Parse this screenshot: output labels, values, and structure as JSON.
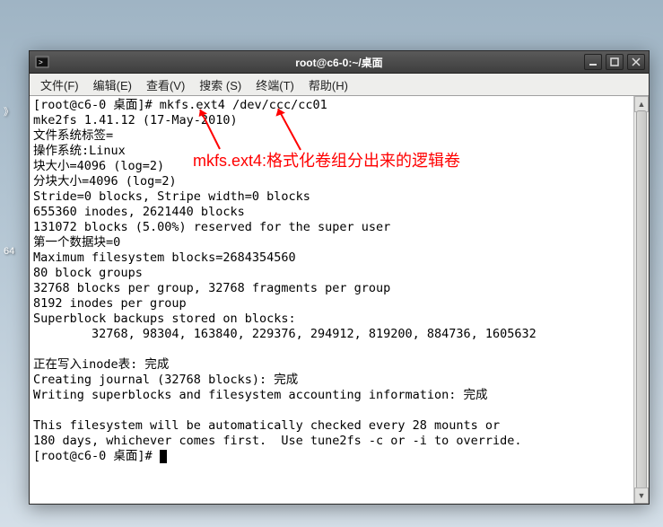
{
  "desktop": {
    "label1": "》",
    "label2": "64"
  },
  "window": {
    "title": "root@c6-0:~/桌面"
  },
  "menubar": {
    "file": "文件(F)",
    "edit": "编辑(E)",
    "view": "查看(V)",
    "search": "搜索 (S)",
    "terminal": "终端(T)",
    "help": "帮助(H)"
  },
  "terminal": {
    "lines": [
      "[root@c6-0 桌面]# mkfs.ext4 /dev/ccc/cc01",
      "mke2fs 1.41.12 (17-May-2010)",
      "文件系统标签=",
      "操作系统:Linux",
      "块大小=4096 (log=2)",
      "分块大小=4096 (log=2)",
      "Stride=0 blocks, Stripe width=0 blocks",
      "655360 inodes, 2621440 blocks",
      "131072 blocks (5.00%) reserved for the super user",
      "第一个数据块=0",
      "Maximum filesystem blocks=2684354560",
      "80 block groups",
      "32768 blocks per group, 32768 fragments per group",
      "8192 inodes per group",
      "Superblock backups stored on blocks:",
      "        32768, 98304, 163840, 229376, 294912, 819200, 884736, 1605632",
      "",
      "正在写入inode表: 完成",
      "Creating journal (32768 blocks): 完成",
      "Writing superblocks and filesystem accounting information: 完成",
      "",
      "This filesystem will be automatically checked every 28 mounts or",
      "180 days, whichever comes first.  Use tune2fs -c or -i to override.",
      "[root@c6-0 桌面]# "
    ]
  },
  "annotation": {
    "text": "mkfs.ext4:格式化卷组分出来的逻辑卷"
  }
}
